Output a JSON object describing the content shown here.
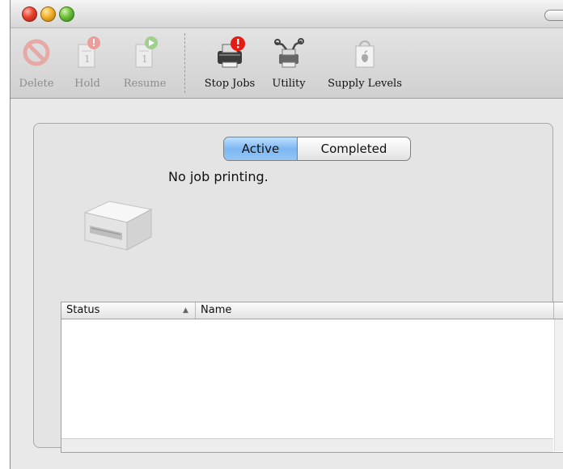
{
  "toolbar": {
    "items": [
      {
        "label": "Delete",
        "icon": "delete-icon",
        "enabled": false
      },
      {
        "label": "Hold",
        "icon": "hold-icon",
        "enabled": false
      },
      {
        "label": "Resume",
        "icon": "resume-icon",
        "enabled": false
      },
      {
        "label": "Stop Jobs",
        "icon": "stop-jobs-icon",
        "enabled": true
      },
      {
        "label": "Utility",
        "icon": "utility-icon",
        "enabled": true
      },
      {
        "label": "Supply Levels",
        "icon": "supply-levels-icon",
        "enabled": true
      }
    ]
  },
  "tabs": {
    "items": [
      {
        "label": "Active",
        "selected": true
      },
      {
        "label": "Completed",
        "selected": false
      }
    ]
  },
  "main": {
    "status_text": "No job printing."
  },
  "table": {
    "columns": [
      {
        "label": "Status",
        "sorted": "ascending"
      },
      {
        "label": "Name"
      }
    ],
    "rows": []
  },
  "colors": {
    "active_tab": "#7db7f2",
    "close_button": "#e8402c",
    "minimize_button": "#f1b12a",
    "zoom_button": "#6cc03a",
    "alert_badge": "#e41b12",
    "resume_badge": "#4aa62a"
  }
}
